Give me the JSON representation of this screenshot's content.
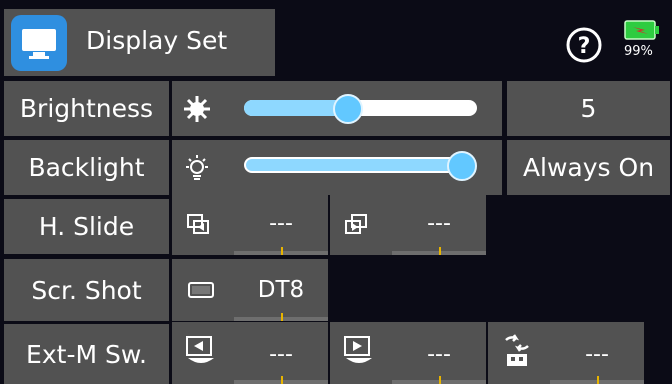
{
  "header": {
    "title": "Display Set",
    "battery_percent": "99%",
    "battery_color": "#2ecc40"
  },
  "rows": {
    "brightness": {
      "label": "Brightness",
      "value": "5",
      "level": 0.5
    },
    "backlight": {
      "label": "Backlight",
      "value": "Always On",
      "level": 1.0
    },
    "hslide": {
      "label": "H. Slide",
      "left": "---",
      "right": "---"
    },
    "screenshot": {
      "label": "Scr. Shot",
      "switch": "DT8"
    },
    "extm": {
      "label": "Ext-M Sw.",
      "sw1": "---",
      "sw2": "---",
      "sw3": "---"
    }
  },
  "icons": {
    "app": "monitor-icon",
    "help": "question-mark-icon",
    "battery": "battery-charging-icon",
    "brightness": "sun-icon",
    "backlight": "bulb-icon",
    "hslide_left": "slide-left-icon",
    "hslide_right": "slide-right-icon",
    "screenshot": "screen-icon",
    "ext1": "prev-icon",
    "ext2": "next-icon",
    "ext3": "swap-icon"
  }
}
